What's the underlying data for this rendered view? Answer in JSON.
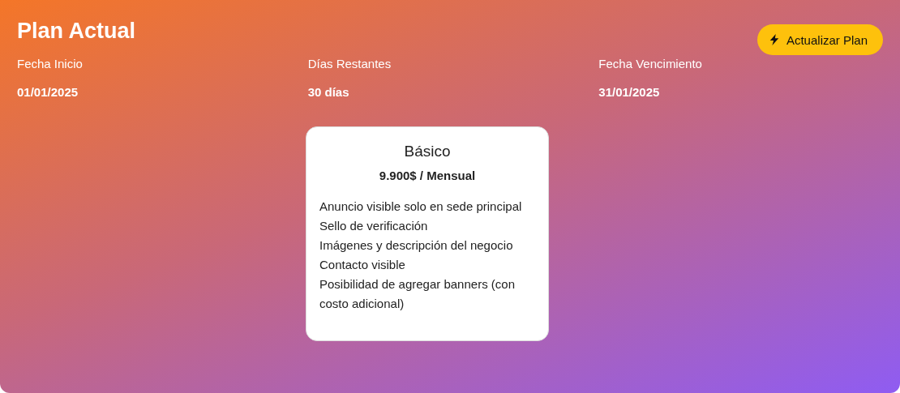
{
  "title": "Plan Actual",
  "update_button": {
    "label": "Actualizar Plan"
  },
  "stats": [
    {
      "label": "Fecha Inicio",
      "value": "01/01/2025"
    },
    {
      "label": "Días Restantes",
      "value": "30 días"
    },
    {
      "label": "Fecha Vencimiento",
      "value": "31/01/2025"
    }
  ],
  "plan_card": {
    "name": "Básico",
    "price": "9.900$ / Mensual",
    "features": [
      "Anuncio visible solo en sede principal",
      "Sello de verificación",
      "Imágenes y descripción del negocio",
      "Contacto visible",
      "Posibilidad de agregar banners (con costo adicional)"
    ]
  }
}
